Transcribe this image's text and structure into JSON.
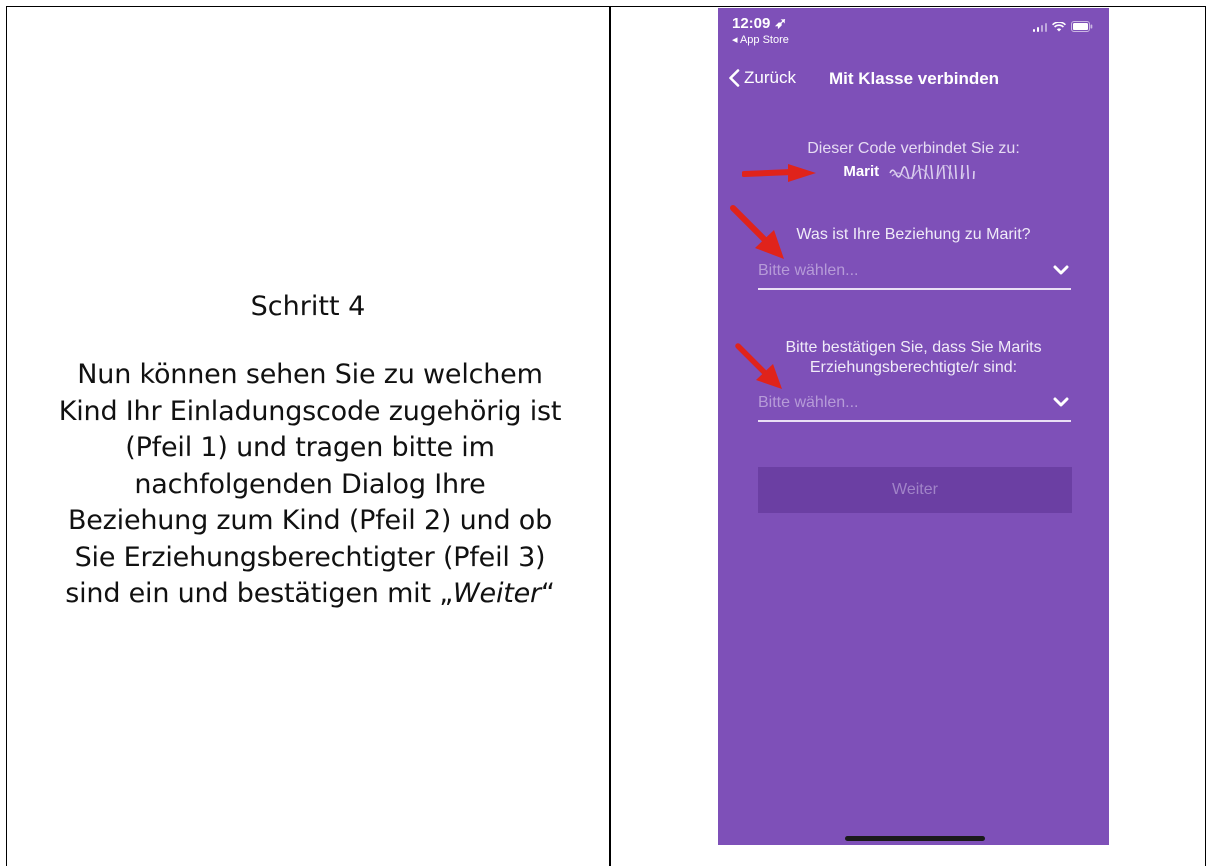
{
  "left_cell": {
    "step_title": "Schritt 4",
    "desc_line1": "Nun können sehen Sie zu welchem",
    "desc_line2": "Kind Ihr Einladungscode zugehörig ist",
    "desc_line3": "(Pfeil 1) und tragen bitte im",
    "desc_line4": "nachfolgenden Dialog Ihre",
    "desc_line5": "Beziehung zum Kind (Pfeil 2) und ob",
    "desc_line6": "Sie Erziehungsberechtigter (Pfeil 3)",
    "desc_line7_prefix": "sind ein und bestätigen mit „",
    "desc_line7_em": "Weiter",
    "desc_line7_suffix": "“"
  },
  "phone": {
    "status_time": "12:09 ➶",
    "status_back": "◂ App Store",
    "nav_back_label": "Zurück",
    "nav_title": "Mit Klasse verbinden",
    "code_text": "Dieser Code verbindet Sie zu:",
    "child_name": "Marit",
    "relation_question": "Was ist Ihre Beziehung zu Marit?",
    "relation_placeholder": "Bitte wählen...",
    "guardian_question_line1": "Bitte bestätigen Sie, dass Sie Marits",
    "guardian_question_line2": "Erziehungsberechtigte/r sind:",
    "guardian_placeholder": "Bitte wählen...",
    "weiter_label": "Weiter",
    "colors": {
      "background": "#7e50b8",
      "button": "#6b3fa3",
      "arrow": "#e0231b"
    }
  }
}
